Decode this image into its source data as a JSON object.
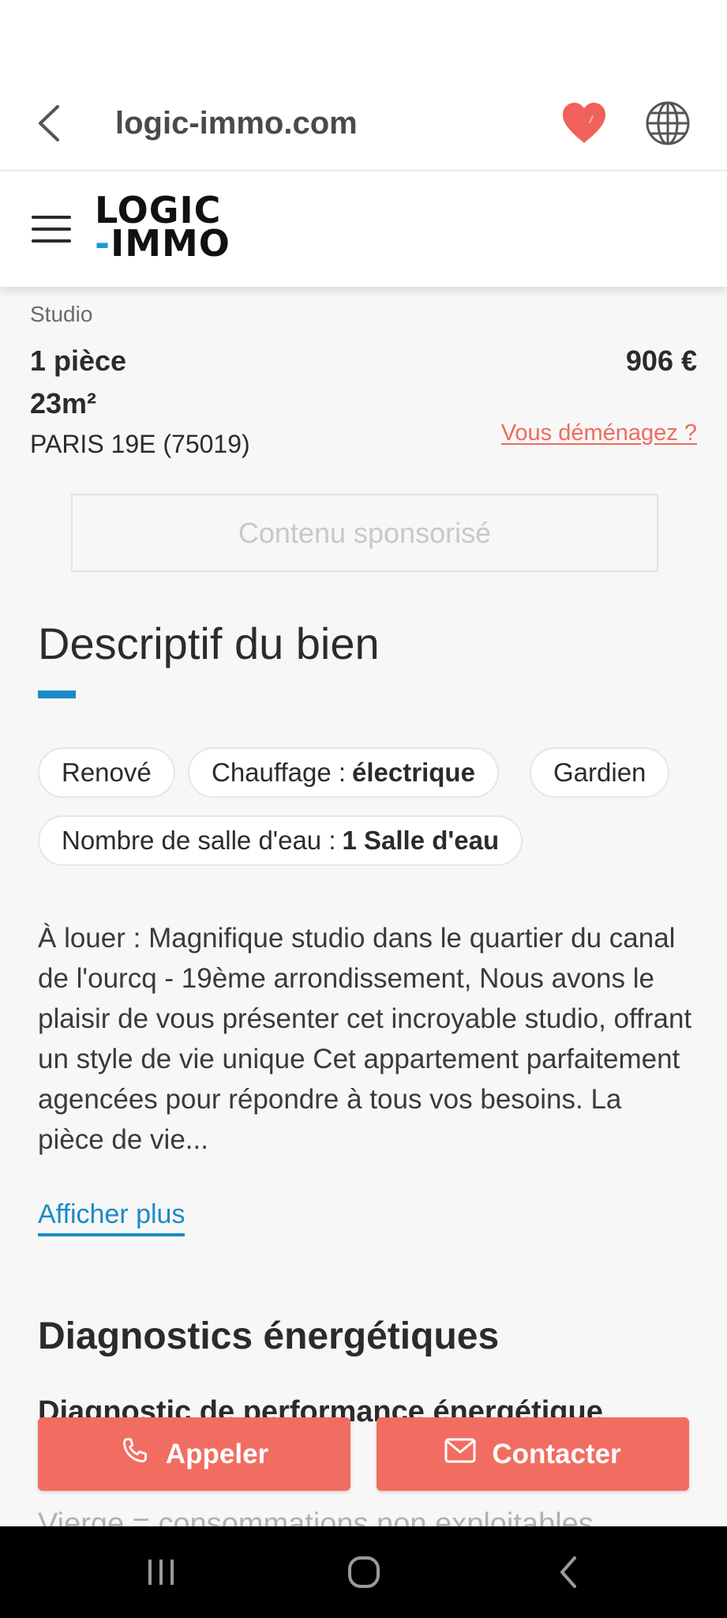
{
  "browser": {
    "url": "logic-immo.com"
  },
  "site": {
    "logo_line1": "LOGIC",
    "logo_dash": "-",
    "logo_line2": "IMMO",
    "accent_color": "#1a9ad6"
  },
  "listing": {
    "type": "Studio",
    "rooms": "1 pièce",
    "surface": "23m²",
    "location": "PARIS 19E (75019)",
    "price": "906 €",
    "moving_link": "Vous déménagez ?",
    "sponsored": "Contenu sponsorisé"
  },
  "description": {
    "title": "Descriptif du bien",
    "chips": [
      {
        "label": "Renové",
        "value": ""
      },
      {
        "label": "Chauffage :",
        "value": "électrique"
      },
      {
        "label": "Gardien",
        "value": ""
      },
      {
        "label": "Nombre de salle d'eau :",
        "value": "1 Salle d'eau"
      }
    ],
    "text": "À louer : Magnifique studio dans le quartier du canal de l'ourcq - 19ème arrondissement, Nous avons le plaisir de vous présenter cet incroyable studio, offrant un style de vie unique Cet appartement parfaitement agencées pour répondre à tous vos besoins. La pièce de vie...",
    "show_more": "Afficher plus"
  },
  "energy": {
    "title": "Diagnostics énergétiques",
    "subtitle": "Diagnostic de performance énergétique",
    "note": "Vierge = consommations non exploitables"
  },
  "actions": {
    "call": "Appeler",
    "contact": "Contacter",
    "button_color": "#f26d61"
  },
  "icons": {
    "back": "back-chevron-icon",
    "favorite": "heart-icon",
    "language": "globe-icon",
    "menu": "hamburger-icon",
    "phone": "phone-icon",
    "mail": "mail-icon"
  }
}
